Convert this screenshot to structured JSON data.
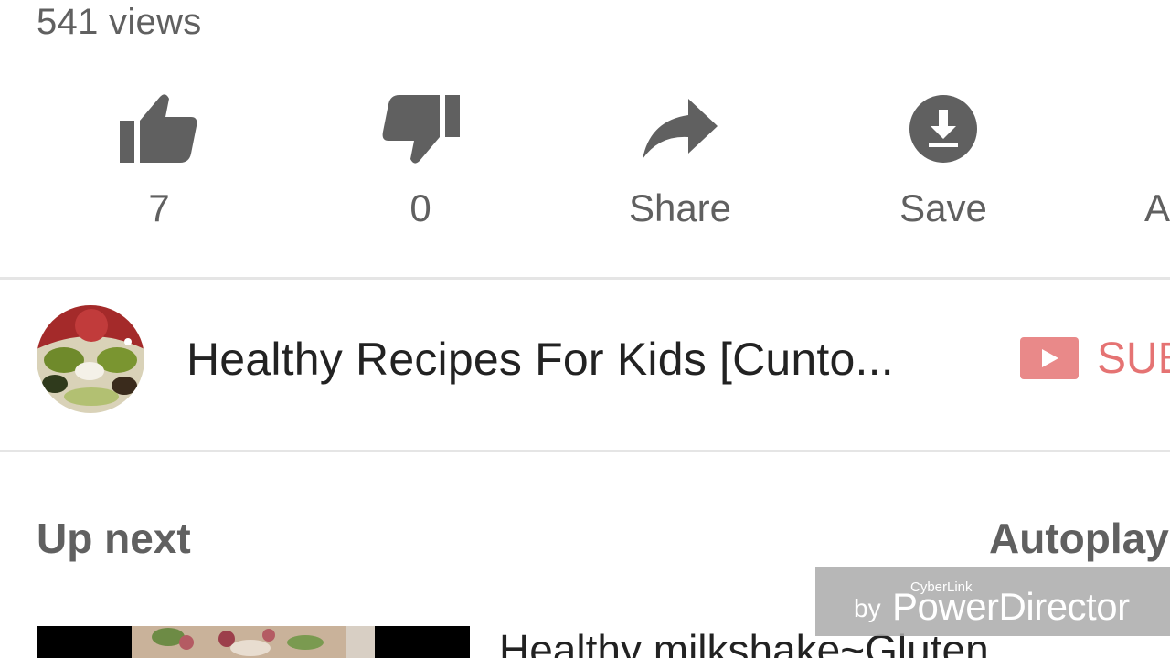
{
  "video": {
    "views": "541 views"
  },
  "actions": {
    "like": {
      "icon": "thumbs-up-icon",
      "label": "7"
    },
    "dislike": {
      "icon": "thumbs-down-icon",
      "label": "0"
    },
    "share": {
      "icon": "share-arrow-icon",
      "label": "Share"
    },
    "save": {
      "icon": "download-icon",
      "label": "Save"
    },
    "add": {
      "label": "A"
    }
  },
  "channel": {
    "name": "Healthy Recipes For Kids [Cunto...",
    "subscribe_label": "SUB"
  },
  "up_next": {
    "heading": "Up next",
    "autoplay_label": "Autoplay",
    "items": [
      {
        "title": "Healthy milkshake~Gluten"
      }
    ]
  },
  "watermark": {
    "brand_small": "CyberLink",
    "by": "by",
    "product": "PowerDirector"
  },
  "colors": {
    "icon_gray": "#606060",
    "subscribe_red": "#e57373",
    "divider": "#e5e5e5"
  }
}
